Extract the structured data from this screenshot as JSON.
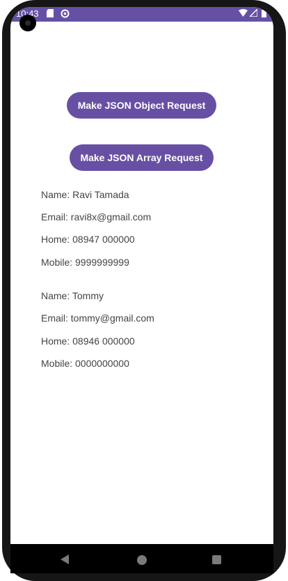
{
  "status_bar": {
    "time": "10:43",
    "background_color": "#6650a4",
    "left_icons": [
      "sd-card-icon",
      "sync-icon"
    ],
    "right_icons": [
      "wifi-icon",
      "signal-icon",
      "battery-icon"
    ]
  },
  "actions": {
    "json_object_button": "Make JSON Object Request",
    "json_array_button": "Make JSON Array Request",
    "button_color": "#6750a4"
  },
  "contacts": [
    {
      "name": "Name: Ravi Tamada",
      "email": "Email: ravi8x@gmail.com",
      "home": "Home: 08947 000000",
      "mobile": "Mobile: 9999999999"
    },
    {
      "name": "Name: Tommy",
      "email": "Email: tommy@gmail.com",
      "home": "Home: 08946 000000",
      "mobile": "Mobile: 0000000000"
    }
  ],
  "navigation": {
    "icons": [
      "back-icon",
      "home-icon",
      "recents-icon"
    ]
  }
}
